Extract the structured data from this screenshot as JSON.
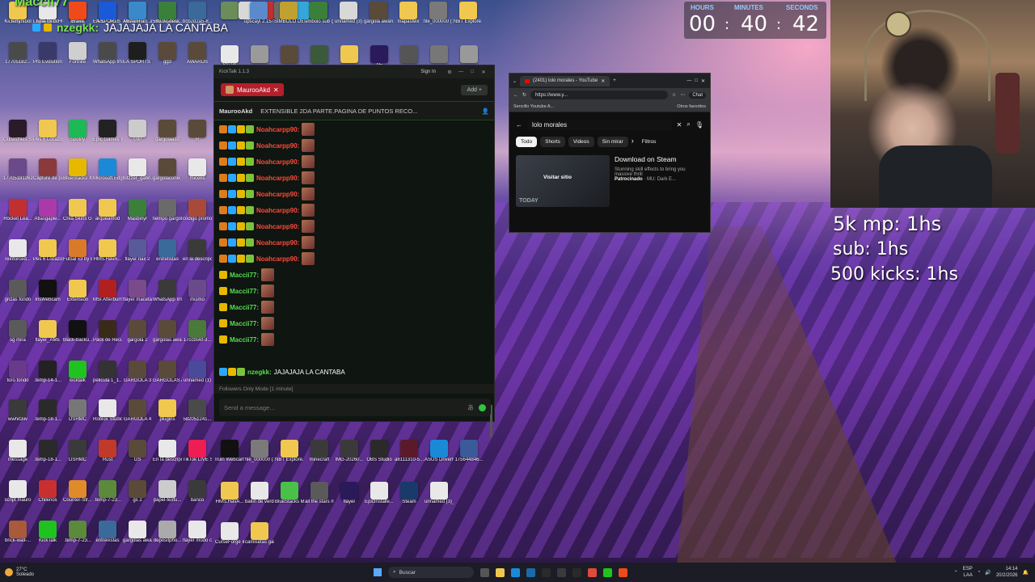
{
  "desktop": {
    "icons": [
      {
        "label": "",
        "color": "#6a8d5a"
      },
      {
        "label": "",
        "color": "#d8d8d8"
      },
      {
        "label": "",
        "color": "#c03030"
      },
      {
        "label": "",
        "color": "#6a6a6a"
      },
      {
        "label": "",
        "color": "#35a6d8"
      },
      {
        "label": "",
        "color": "#5b5b9b"
      },
      {
        "label": "upscayl 2.15.0",
        "color": "#5a8acb"
      },
      {
        "label": "SIMBOLO DE CUB",
        "color": "#c0a030"
      },
      {
        "label": "simbolo sub gold",
        "color": "#3a7f3a"
      },
      {
        "label": "unnamed (3)",
        "color": "#d8d8d8"
      },
      {
        "label": "gargola award2026",
        "color": "#5a4a3a"
      },
      {
        "label": "mapastwx",
        "color": "#f0c850"
      },
      {
        "label": "file_000000 (1)",
        "color": "#7a7a7a"
      },
      {
        "label": "NBT Explore...",
        "color": "#f0c850"
      },
      {
        "label": "17705182...",
        "color": "#4a4a4a"
      },
      {
        "label": "Pro Evolution Soccer 6",
        "color": "#3a3a6a"
      },
      {
        "label": "Fortnite",
        "color": "#cfcfcf"
      },
      {
        "label": "WhatsApp Image 2026...",
        "color": "#4a4a4a"
      },
      {
        "label": "EA SPORTS FC 26",
        "color": "#1e1e1e"
      },
      {
        "label": "gg3",
        "color": "#5a4a3a"
      },
      {
        "label": "AWARDS",
        "color": "#5a4a3a"
      },
      {
        "label": "Steam",
        "color": "#e8e8e8"
      },
      {
        "label": "",
        "color": "#9a9a9a"
      },
      {
        "label": "",
        "color": "#5a4a3a"
      },
      {
        "label": "",
        "color": "#3a5a3a"
      },
      {
        "label": "",
        "color": "#f0c850"
      },
      {
        "label": "AE",
        "color": "#2a1a5a"
      },
      {
        "label": "",
        "color": "#555555"
      },
      {
        "label": "",
        "color": "#777777"
      },
      {
        "label": "",
        "color": "#999999"
      },
      {
        "label": "Outlastfiles Streams",
        "color": "#2a1a2a"
      },
      {
        "label": "Pes 6 Locazos",
        "color": "#f0c850"
      },
      {
        "label": "Spotify",
        "color": "#1db954"
      },
      {
        "label": "Epic Games Launcher",
        "color": "#222222"
      },
      {
        "label": "GIP",
        "color": "#cccccc"
      },
      {
        "label": "gargolaasd",
        "color": "#5a4a3a"
      },
      {
        "label": "R",
        "color": "#5a4a3a"
      },
      {
        "label": "17705181262...",
        "color": "#6a4a8a"
      },
      {
        "label": "Capture de pantalla",
        "color": "#8a3a3a"
      },
      {
        "label": "BlueStacks X",
        "color": "#e6b800"
      },
      {
        "label": "Microsoft Edge",
        "color": "#1a8ad8"
      },
      {
        "label": "bitzzer_gabri...",
        "color": "#e8e8e8"
      },
      {
        "label": "gargolaconix...",
        "color": "#5a4a3a"
      },
      {
        "label": "miceks",
        "color": "#e8e8e8"
      },
      {
        "label": "Rocket Lea...",
        "color": "#c03030"
      },
      {
        "label": "Atlasgaple...",
        "color": "#aa3aaa"
      },
      {
        "label": "Crea Skins Gen",
        "color": "#f0c850"
      },
      {
        "label": "arqueamod",
        "color": "#f0c850"
      },
      {
        "label": "Masbinyr",
        "color": "#3a7f3a"
      },
      {
        "label": "tiempo gargola",
        "color": "#6a6a6a"
      },
      {
        "label": "codigo promocion...",
        "color": "#a84a3a"
      },
      {
        "label": "reinforced...",
        "color": "#e8e8e8"
      },
      {
        "label": "Pes 6 Locazos",
        "color": "#f0c850"
      },
      {
        "label": "Futsal x3 by Bazinga fro...",
        "color": "#d87a2a"
      },
      {
        "label": "HMS.HavA...",
        "color": "#f0c850"
      },
      {
        "label": "flayer nax 2",
        "color": "#5a5a9a"
      },
      {
        "label": "entrefistas",
        "color": "#3a6a9a"
      },
      {
        "label": "en la descripcio...",
        "color": "#3a3a3a"
      },
      {
        "label": "grizas fondo",
        "color": "#5a5a5a"
      },
      {
        "label": "IrisWebcam",
        "color": "#111111"
      },
      {
        "label": "Extension",
        "color": "#f0c850"
      },
      {
        "label": "MSI Afterburner",
        "color": "#b02020"
      },
      {
        "label": "flayer maceta",
        "color": "#7a4a8a"
      },
      {
        "label": "WhatsApp Image 2026...",
        "color": "#3a3a3a"
      },
      {
        "label": "mismo",
        "color": "#6a4a8a"
      },
      {
        "label": "sg mira",
        "color": "#5a5a5a"
      },
      {
        "label": "flayer_AME",
        "color": "#f0c850"
      },
      {
        "label": "black-backu...",
        "color": "#111111"
      },
      {
        "label": "Pack de Recursos",
        "color": "#3a2a1a"
      },
      {
        "label": "gargola 2",
        "color": "#5a4a3a"
      },
      {
        "label": "gargolas awards",
        "color": "#5a4a3a"
      },
      {
        "label": "17ccb56f-3...",
        "color": "#4a7a3a"
      },
      {
        "label": "toro fondo",
        "color": "#6a3a8a"
      },
      {
        "label": ".temp-14-1...",
        "color": "#222222"
      },
      {
        "label": "kicktalk",
        "color": "#1fc21f"
      },
      {
        "label": "pelicula 1_1...",
        "color": "#333333"
      },
      {
        "label": "GARGOLA 3",
        "color": "#5a4a3a"
      },
      {
        "label": "GARGOLAS AWARSD",
        "color": "#5a4a3a"
      },
      {
        "label": "unnamed (1)",
        "color": "#4a4a9a"
      },
      {
        "label": "wwhit3iiv",
        "color": "#3a3a3a"
      },
      {
        "label": ".temp-18-1...",
        "color": "#2a2a2a"
      },
      {
        "label": "DSHMC",
        "color": "#777777"
      },
      {
        "label": "Roblox Studio",
        "color": "#e8e8e8"
      },
      {
        "label": "GARGOLA 4",
        "color": "#5a4a3a"
      },
      {
        "label": "plugins",
        "color": "#f0c850"
      },
      {
        "label": "582051241...",
        "color": "#4a4a4a"
      },
      {
        "label": "message",
        "color": "#e8e8e8"
      },
      {
        "label": ".temp-18-1...",
        "color": "#2a2a2a"
      },
      {
        "label": "DSHMC",
        "color": "#3a3a3a"
      },
      {
        "label": "Rust",
        "color": "#c03a2a"
      },
      {
        "label": "GS",
        "color": "#5a4a3a"
      },
      {
        "label": "En la descripció...",
        "color": "#e8e8e8"
      },
      {
        "label": "TikTok LIVE Studio",
        "color": "#ee1d52"
      },
      {
        "label": "script mauro",
        "color": "#e8e8e8"
      },
      {
        "label": "Chilenos",
        "color": "#c83030"
      },
      {
        "label": "Counter-Str... 2",
        "color": "#e08a2a"
      },
      {
        "label": ".temp-7-23...",
        "color": "#5a8a3a"
      },
      {
        "label": "gs 2",
        "color": "#5a4a3a"
      },
      {
        "label": "papel-textu...",
        "color": "#cccccc"
      },
      {
        "label": "banco",
        "color": "#3a3a3a"
      },
      {
        "label": "brick-wall-...",
        "color": "#a85a3a"
      },
      {
        "label": "KickTalk",
        "color": "#1fc21f"
      },
      {
        "label": ".temp-7-23...",
        "color": "#5a8a3a"
      },
      {
        "label": "entrevistas",
        "color": "#3a6a9a"
      },
      {
        "label": "gargolas awards",
        "color": "#e8e8e8"
      },
      {
        "label": "depositpho...",
        "color": "#aaaaaa"
      },
      {
        "label": "flayer modo carrera",
        "color": "#e8e8e8"
      },
      {
        "label": "Kick-Symbol",
        "color": "#1fc21f"
      },
      {
        "label": "Logitech G HUB",
        "color": "#e8e8e8"
      },
      {
        "label": "micros",
        "color": "#cccccc"
      },
      {
        "label": "IMG_2417",
        "color": "#cccccc"
      },
      {
        "label": "Almacena... automátic...",
        "color": "#f0c850"
      },
      {
        "label": "istockphot...",
        "color": "#e8e8e8"
      },
      {
        "label": "bcb2d2a5-8...",
        "color": "#3a6a9a"
      },
      {
        "label": "remini",
        "color": "#f0c850"
      },
      {
        "label": "luna fondo",
        "color": "#e8e8e8"
      },
      {
        "label": "Brave",
        "color": "#f04a1a"
      },
      {
        "label": "EA SPORTS FC 26",
        "color": "#1a5ad8"
      },
      {
        "label": "MisterHorri...",
        "color": "#3a8acb"
      },
      {
        "label": "580.97-desk...",
        "color": "#3a7f3a"
      },
      {
        "label": "Iruin Webcam",
        "color": "#111111"
      },
      {
        "label": "file_000000 (1)_upscay...",
        "color": "#7a7a7a"
      },
      {
        "label": "NBT Explore...",
        "color": "#f0c850"
      },
      {
        "label": "minecraft",
        "color": "#3a3a3a"
      },
      {
        "label": "IMG-20260...",
        "color": "#3a3a3a"
      },
      {
        "label": "OBS Studio",
        "color": "#2a2a2a"
      },
      {
        "label": "a8111310-5...",
        "color": "#5a1a2a"
      },
      {
        "label": "ASUS DriverHub",
        "color": "#1a8ad8"
      },
      {
        "label": "175644846...",
        "color": "#3a5a9a"
      },
      {
        "label": "HMS.HavA...",
        "color": "#f0c850"
      },
      {
        "label": "ballin de verdad",
        "color": "#e8e8e8"
      },
      {
        "label": "BlueStacks Multi-Insta...",
        "color": "#4ac04a"
      },
      {
        "label": "all the stars malta.afd",
        "color": "#5a5a5a"
      },
      {
        "label": "flayer",
        "color": "#2a1a5a"
      },
      {
        "label": "EpicInstalle...",
        "color": "#e8e8e8"
      },
      {
        "label": "Steam",
        "color": "#1a3a6a"
      },
      {
        "label": "unnamed (3)_upscayl...",
        "color": "#e8e8e8"
      },
      {
        "label": "CurseForge Installer",
        "color": "#e8e8e8"
      },
      {
        "label": "camisetas gargolas",
        "color": "#f0c850"
      }
    ]
  },
  "overlay": {
    "alert_name": "Maccii77",
    "alert_msg_nick": "nzegkk:",
    "alert_msg_text": "JAJAJAJA LA CANTABA"
  },
  "kicktalk": {
    "window_title": "KickTalk 1.1.3",
    "sign_in": "Sign In",
    "tab_label": "MaurooAkd",
    "add_label": "Add",
    "channel_name": "MaurooAkd",
    "stream_title": "EXTENSIBLE 2DA PARTE.PAGINA DE PUNTOS RECO...",
    "messages": [
      {
        "nick": "Noahcarpp90:",
        "color": "#ff4a3a",
        "badges": [
          "o",
          "bl",
          "y",
          "g"
        ]
      },
      {
        "nick": "Noahcarpp90:",
        "color": "#ff4a3a",
        "badges": [
          "o",
          "bl",
          "y",
          "g"
        ]
      },
      {
        "nick": "Noahcarpp90:",
        "color": "#ff4a3a",
        "badges": [
          "o",
          "bl",
          "y",
          "g"
        ]
      },
      {
        "nick": "Noahcarpp90:",
        "color": "#ff4a3a",
        "badges": [
          "o",
          "bl",
          "y",
          "g"
        ]
      },
      {
        "nick": "Noahcarpp90:",
        "color": "#ff4a3a",
        "badges": [
          "o",
          "bl",
          "y",
          "g"
        ]
      },
      {
        "nick": "Noahcarpp90:",
        "color": "#ff4a3a",
        "badges": [
          "o",
          "bl",
          "y",
          "g"
        ]
      },
      {
        "nick": "Noahcarpp90:",
        "color": "#ff4a3a",
        "badges": [
          "o",
          "bl",
          "y",
          "g"
        ]
      },
      {
        "nick": "Noahcarpp90:",
        "color": "#ff4a3a",
        "badges": [
          "o",
          "bl",
          "y",
          "g"
        ]
      },
      {
        "nick": "Noahcarpp90:",
        "color": "#ff4a3a",
        "badges": [
          "o",
          "bl",
          "y",
          "g"
        ]
      },
      {
        "nick": "Maccii77:",
        "color": "#53e04f",
        "badges": [
          "y"
        ]
      },
      {
        "nick": "Maccii77:",
        "color": "#53e04f",
        "badges": [
          "y"
        ]
      },
      {
        "nick": "Maccii77:",
        "color": "#53e04f",
        "badges": [
          "y"
        ]
      },
      {
        "nick": "Maccii77:",
        "color": "#53e04f",
        "badges": [
          "y"
        ]
      },
      {
        "nick": "Maccii77:",
        "color": "#53e04f",
        "badges": [
          "y"
        ]
      }
    ],
    "last_message": {
      "nick": "nzegkk:",
      "text": "JAJAJAJA LA CANTABA",
      "color": "#53e04f"
    },
    "follow_notice": "Followers Only Mode [1 minute]",
    "input_placeholder": "Send a message..."
  },
  "browser": {
    "tab_title": "(2401) lolo morales - YouTube",
    "url": "https://www.y...",
    "chat_label": "Chat",
    "bookmark": "Sencillo Youtube A...",
    "other_favorites": "Otros favoritos",
    "search_query": "lolo morales",
    "chips": [
      "Todo",
      "Shorts",
      "Videos",
      "Sin mirar"
    ],
    "filters": "Filtros",
    "ad": {
      "title": "Download on Steam",
      "desc": "Stunning skill effects to bring you massive thrill",
      "sponsored": "Patrocinado",
      "advertiser": "MU: Dark E...",
      "visit": "Visitar sitio",
      "thumb_text": "TODAY"
    }
  },
  "timer": {
    "hours_label": "HOURS",
    "minutes_label": "MINUTES",
    "seconds_label": "SECONDS",
    "hours": "00",
    "minutes": "40",
    "seconds": "42",
    "sep": ":"
  },
  "goals": [
    "5k mp: 1hs",
    "sub: 1hs",
    "500 kicks: 1hs"
  ],
  "taskbar": {
    "temp": "27°C",
    "weather": "Soleado",
    "search": "Buscar",
    "lang": "ESP",
    "lang2": "LAA",
    "time": "14:14",
    "date": "20/2/2026"
  }
}
